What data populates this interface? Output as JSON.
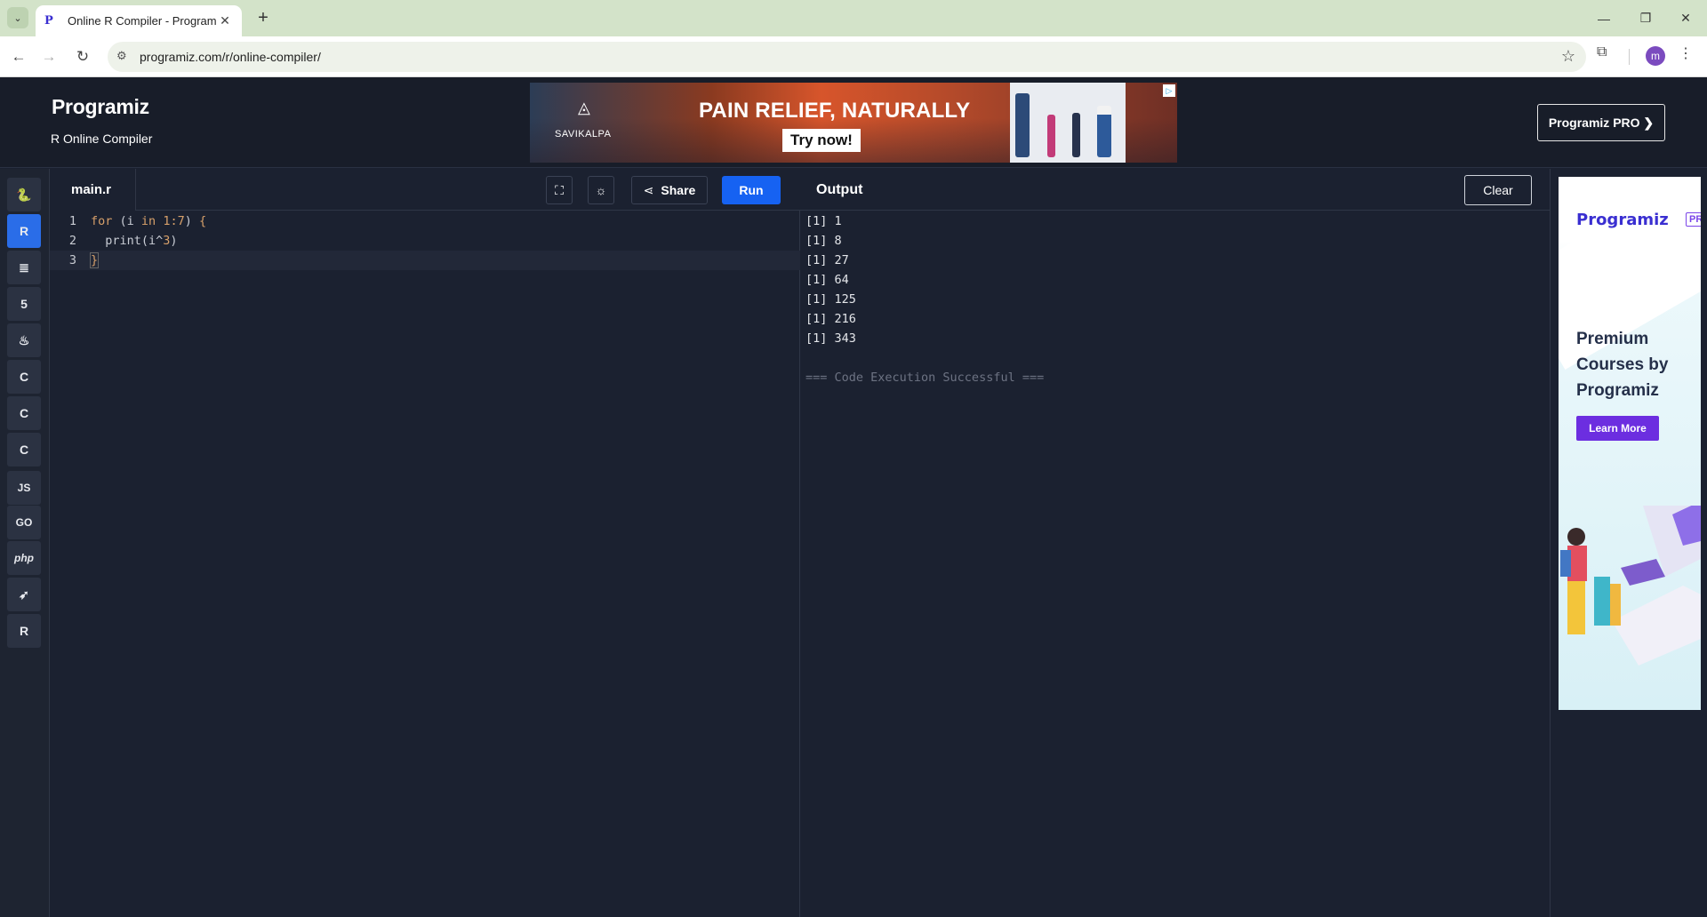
{
  "browser": {
    "tab_title": "Online R Compiler - Programiz",
    "url": "programiz.com/r/online-compiler/",
    "profile_initial": "m"
  },
  "header": {
    "brand": "Programiz",
    "subtitle": "R Online Compiler",
    "pro_button": "Programiz PRO ❯"
  },
  "top_ad": {
    "brand": "SAVIKALPA",
    "headline": "PAIN RELIEF, NATURALLY",
    "cta": "Try now!"
  },
  "sidebar": {
    "languages": [
      {
        "name": "python",
        "glyph": "🐍",
        "active": false
      },
      {
        "name": "r",
        "glyph": "R",
        "active": true
      },
      {
        "name": "sql",
        "glyph": "≣",
        "active": false
      },
      {
        "name": "html",
        "glyph": "5",
        "active": false
      },
      {
        "name": "java",
        "glyph": "♨",
        "active": false
      },
      {
        "name": "c",
        "glyph": "C",
        "active": false
      },
      {
        "name": "cpp",
        "glyph": "C",
        "active": false
      },
      {
        "name": "csharp",
        "glyph": "C",
        "active": false
      },
      {
        "name": "javascript",
        "glyph": "JS",
        "active": false
      },
      {
        "name": "go",
        "glyph": "GO",
        "active": false
      },
      {
        "name": "php",
        "glyph": "php",
        "active": false
      },
      {
        "name": "swift",
        "glyph": "➶",
        "active": false
      },
      {
        "name": "rust",
        "glyph": "R",
        "active": false
      }
    ]
  },
  "editor": {
    "filename": "main.r",
    "share_label": "Share",
    "run_label": "Run",
    "lines": [
      {
        "num": "1",
        "text": "for (i in 1:7) {"
      },
      {
        "num": "2",
        "text": "  print(i^3)"
      },
      {
        "num": "3",
        "text": "}"
      }
    ]
  },
  "output": {
    "title": "Output",
    "clear_label": "Clear",
    "lines": [
      "[1] 1",
      "[1] 8",
      "[1] 27",
      "[1] 64",
      "[1] 125",
      "[1] 216",
      "[1] 343"
    ],
    "status": "=== Code Execution Successful ==="
  },
  "side_ad": {
    "brand": "Programiz",
    "pro_badge": "PRO",
    "text": "Premium Courses by Programiz",
    "cta": "Learn More"
  }
}
